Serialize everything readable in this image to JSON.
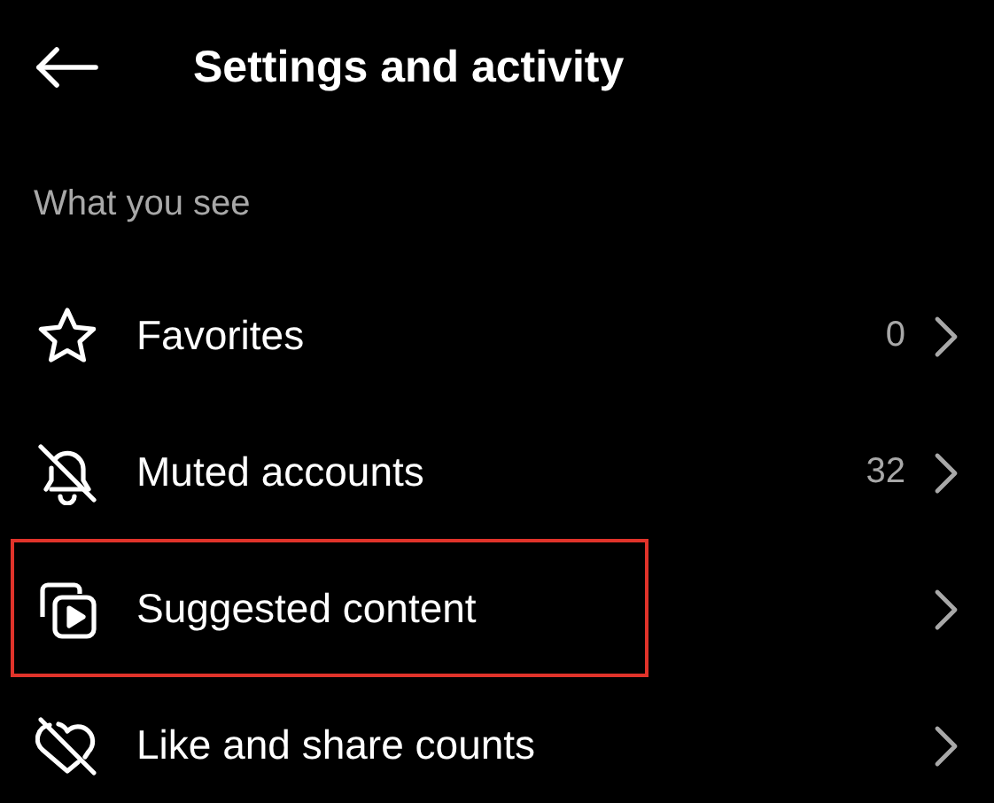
{
  "header": {
    "title": "Settings and activity"
  },
  "section": {
    "label": "What you see"
  },
  "items": [
    {
      "label": "Favorites",
      "count": "0",
      "highlighted": false
    },
    {
      "label": "Muted accounts",
      "count": "32",
      "highlighted": false
    },
    {
      "label": "Suggested content",
      "highlighted": true
    },
    {
      "label": "Like and share counts",
      "highlighted": false
    }
  ]
}
